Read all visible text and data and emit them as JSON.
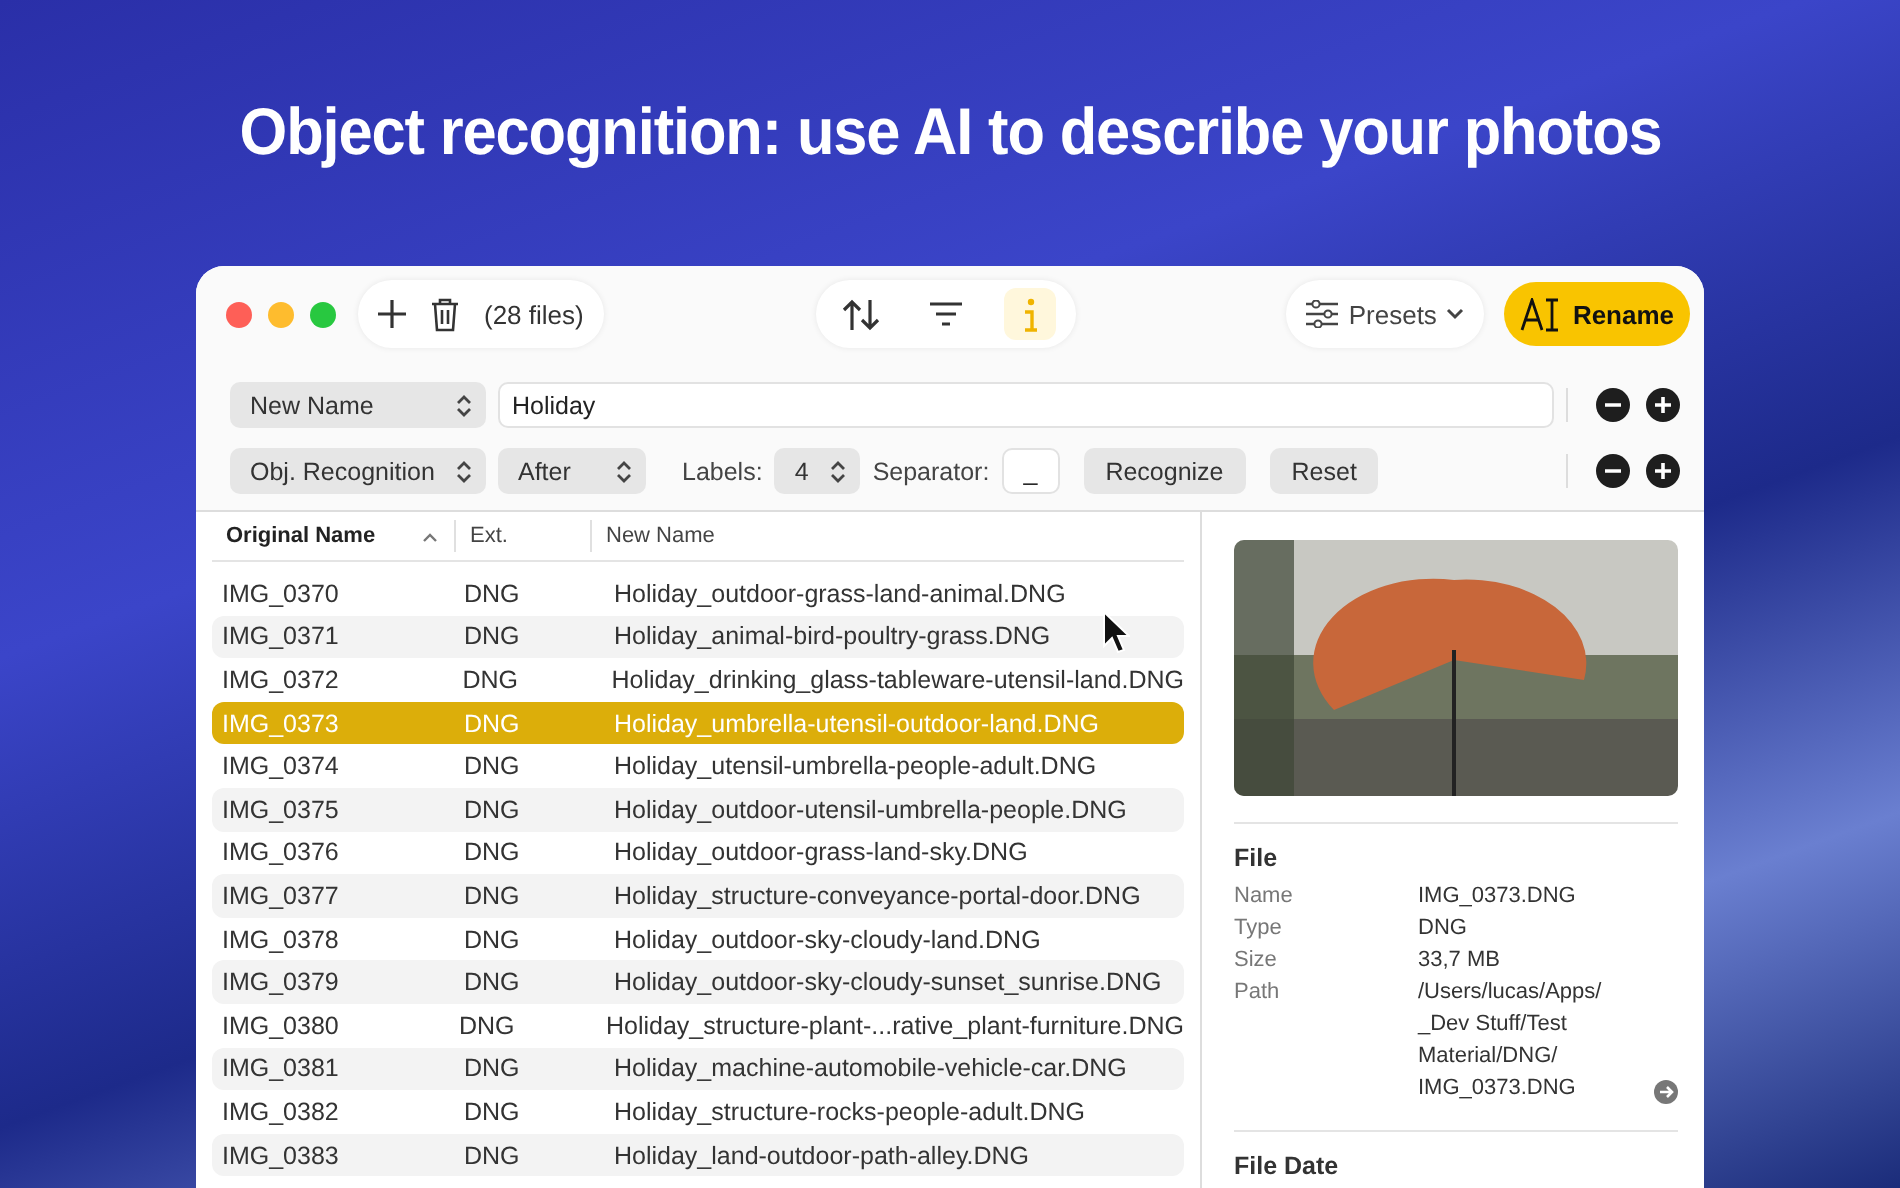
{
  "headline": "Object recognition: use AI to describe your photos",
  "toolbar": {
    "file_count": "(28 files)",
    "view_buttons": [
      {
        "kind": "sort",
        "selected": false
      },
      {
        "kind": "filter",
        "selected": false
      },
      {
        "kind": "info",
        "selected": true
      }
    ],
    "presets": "Presets",
    "rename": "Rename"
  },
  "rules": [
    {
      "kind": "text",
      "type": "New Name",
      "text": "Holiday"
    },
    {
      "kind": "recognition",
      "type": "Obj. Recognition",
      "position": "After",
      "labels_label": "Labels:",
      "labels": "4",
      "separator_label": "Separator:",
      "separator": "_",
      "buttons": [
        "Recognize",
        "Reset"
      ]
    }
  ],
  "table": {
    "columns": [
      {
        "label": "Original Name",
        "sorted": true
      },
      {
        "label": "Ext.",
        "sorted": false
      },
      {
        "label": "New Name",
        "sorted": false
      }
    ],
    "rows": [
      {
        "original": "IMG_0370",
        "ext": "DNG",
        "new_name": "Holiday_outdoor-grass-land-animal.DNG",
        "selected": false
      },
      {
        "original": "IMG_0371",
        "ext": "DNG",
        "new_name": "Holiday_animal-bird-poultry-grass.DNG",
        "selected": false
      },
      {
        "original": "IMG_0372",
        "ext": "DNG",
        "new_name": "Holiday_drinking_glass-tableware-utensil-land.DNG",
        "selected": false
      },
      {
        "original": "IMG_0373",
        "ext": "DNG",
        "new_name": "Holiday_umbrella-utensil-outdoor-land.DNG",
        "selected": true
      },
      {
        "original": "IMG_0374",
        "ext": "DNG",
        "new_name": "Holiday_utensil-umbrella-people-adult.DNG",
        "selected": false
      },
      {
        "original": "IMG_0375",
        "ext": "DNG",
        "new_name": "Holiday_outdoor-utensil-umbrella-people.DNG",
        "selected": false
      },
      {
        "original": "IMG_0376",
        "ext": "DNG",
        "new_name": "Holiday_outdoor-grass-land-sky.DNG",
        "selected": false
      },
      {
        "original": "IMG_0377",
        "ext": "DNG",
        "new_name": "Holiday_structure-conveyance-portal-door.DNG",
        "selected": false
      },
      {
        "original": "IMG_0378",
        "ext": "DNG",
        "new_name": "Holiday_outdoor-sky-cloudy-land.DNG",
        "selected": false
      },
      {
        "original": "IMG_0379",
        "ext": "DNG",
        "new_name": "Holiday_outdoor-sky-cloudy-sunset_sunrise.DNG",
        "selected": false
      },
      {
        "original": "IMG_0380",
        "ext": "DNG",
        "new_name": "Holiday_structure-plant-...rative_plant-furniture.DNG",
        "selected": false
      },
      {
        "original": "IMG_0381",
        "ext": "DNG",
        "new_name": "Holiday_machine-automobile-vehicle-car.DNG",
        "selected": false
      },
      {
        "original": "IMG_0382",
        "ext": "DNG",
        "new_name": "Holiday_structure-rocks-people-adult.DNG",
        "selected": false
      },
      {
        "original": "IMG_0383",
        "ext": "DNG",
        "new_name": "Holiday_land-outdoor-path-alley.DNG",
        "selected": false
      }
    ]
  },
  "inspector": {
    "sections": [
      {
        "title": "File",
        "fields": [
          {
            "key": "Name",
            "value": "IMG_0373.DNG"
          },
          {
            "key": "Type",
            "value": "DNG"
          },
          {
            "key": "Size",
            "value": "33,7 MB"
          },
          {
            "key": "Path",
            "value": "/Users/lucas/Apps/ _Dev Stuff/Test Material/DNG/ IMG_0373.DNG",
            "reveal": true
          }
        ]
      },
      {
        "title": "File Date"
      }
    ]
  }
}
